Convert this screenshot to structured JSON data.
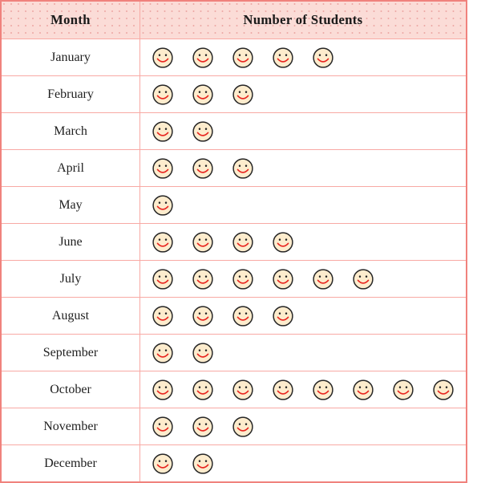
{
  "table": {
    "headers": {
      "month": "Month",
      "students": "Number of Students"
    },
    "icon_name": "smiley-face-icon",
    "colors": {
      "border": "#f0827d",
      "inner_border": "#f8a9a4",
      "header_background": "#fbdcd7",
      "smiley_fill": "#fdeccd",
      "smiley_outline": "#262626",
      "smiley_mouth": "#e8241f",
      "text": "#1f1f1f"
    },
    "rows": [
      {
        "month": "January",
        "count": 5
      },
      {
        "month": "February",
        "count": 3
      },
      {
        "month": "March",
        "count": 2
      },
      {
        "month": "April",
        "count": 3
      },
      {
        "month": "May",
        "count": 1
      },
      {
        "month": "June",
        "count": 4
      },
      {
        "month": "July",
        "count": 6
      },
      {
        "month": "August",
        "count": 4
      },
      {
        "month": "September",
        "count": 2
      },
      {
        "month": "October",
        "count": 8
      },
      {
        "month": "November",
        "count": 3
      },
      {
        "month": "December",
        "count": 2
      }
    ]
  },
  "chart_data": {
    "type": "table",
    "title": "",
    "xlabel": "Month",
    "ylabel": "Number of Students",
    "categories": [
      "January",
      "February",
      "March",
      "April",
      "May",
      "June",
      "July",
      "August",
      "September",
      "October",
      "November",
      "December"
    ],
    "values": [
      5,
      3,
      2,
      3,
      1,
      4,
      6,
      4,
      2,
      8,
      3,
      2
    ],
    "legend": [],
    "notes": "Pictograph: each smiley face icon represents 1 student."
  }
}
